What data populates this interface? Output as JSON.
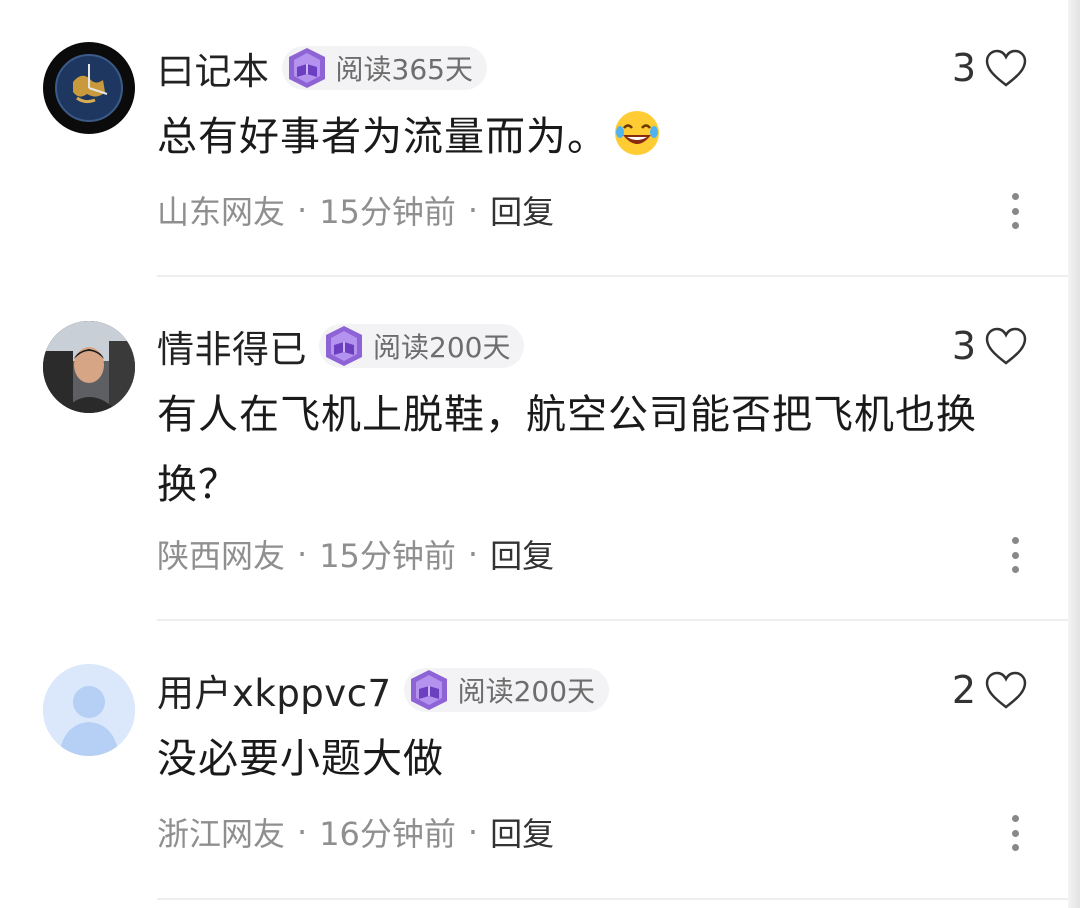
{
  "comments": [
    {
      "username": "曰记本",
      "badge": "阅读365天",
      "likes": "3",
      "text": "总有好事者为流量而为。",
      "location": "山东网友",
      "time": "15分钟前",
      "reply": "回复",
      "avatar_icon": "watch-avatar",
      "emoji": "laugh-tears-emoji"
    },
    {
      "username": "情非得已",
      "badge": "阅读200天",
      "likes": "3",
      "text": "有人在飞机上脱鞋，航空公司能否把飞机也换换？",
      "location": "陕西网友",
      "time": "15分钟前",
      "reply": "回复",
      "avatar_icon": "man-in-car-photo-avatar"
    },
    {
      "username": "用户xkppvc7",
      "badge": "阅读200天",
      "likes": "2",
      "text": "没必要小题大做",
      "location": "浙江网友",
      "time": "16分钟前",
      "reply": "回复",
      "avatar_icon": "default-user-avatar"
    }
  ],
  "separator": "·",
  "colors": {
    "meta_text": "#8f8f8f",
    "badge_bg": "#f3f3f5",
    "badge_purple": "#7b4fc9",
    "default_avatar_bg": "#dbe8fb",
    "default_avatar_fg": "#b5cff5"
  }
}
